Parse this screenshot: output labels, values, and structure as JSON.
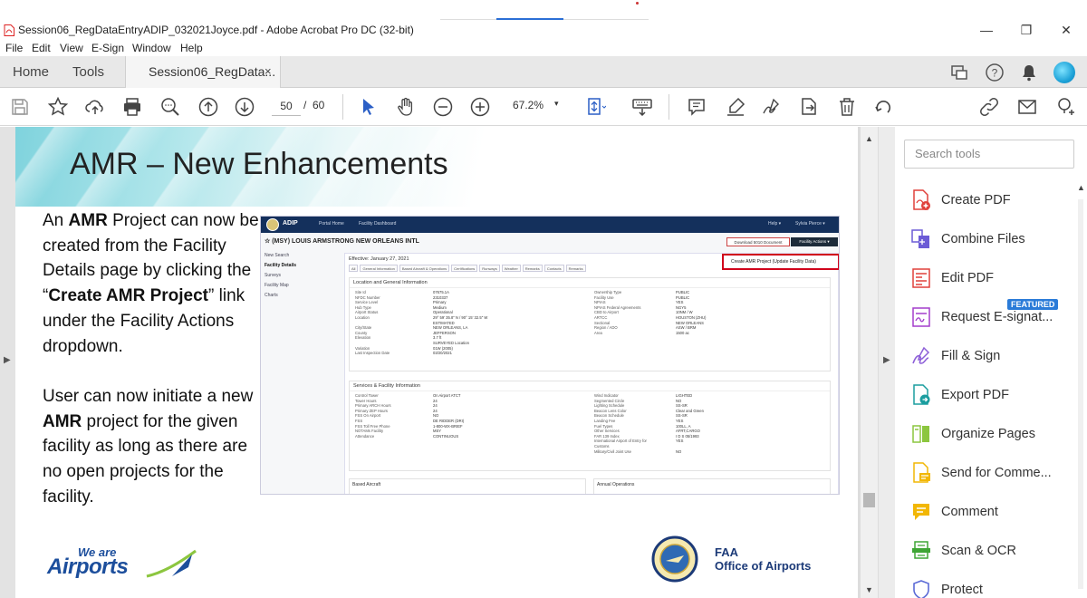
{
  "window": {
    "title": "Session06_RegDataEntryADIP_032021Joyce.pdf - Adobe Acrobat Pro DC (32-bit)",
    "controls": {
      "minimize": "—",
      "restore": "❐",
      "close": "✕"
    }
  },
  "menu": [
    "File",
    "Edit",
    "View",
    "E-Sign",
    "Window",
    "Help"
  ],
  "tabs": {
    "home": "Home",
    "tools": "Tools",
    "document": "Session06_RegData...",
    "close": "×"
  },
  "toolbar": {
    "page_current": "50",
    "page_sep": "/",
    "page_total": "60",
    "zoom": "67.2%",
    "zoom_caret": "▾"
  },
  "colors": {
    "accent_blue": "#2b6fd6",
    "featured_badge": "#2a7bd8",
    "adip_nav": "#14305c",
    "highlight_red": "#d0021b"
  },
  "slide": {
    "title": "AMR – New Enhancements",
    "para1": {
      "t1": "An ",
      "b1": "AMR",
      "t2": " Project can now be created from the Facility Details page by clicking the “",
      "b2": "Create AMR Project",
      "t3": "” link under the Facility Actions dropdown."
    },
    "para2": {
      "t1": "User can now initiate a new ",
      "b1": "AMR",
      "t2": " project for the given facility as long as there are no open projects for the facility."
    },
    "logo_we_are": "We are",
    "logo_airports": "Airports",
    "faa_line1": "FAA",
    "faa_line2": "Office of Airports"
  },
  "screenshot": {
    "brand": "ADIP",
    "nav_links": [
      "Portal Home",
      "Facility Dashboard"
    ],
    "nav_right": [
      "Help ▾",
      "Sylvia Pierce ▾"
    ],
    "facility_title": "☆ (MSY) LOUIS ARMSTRONG NEW ORLEANS INTL",
    "btn_download": "Download 5010 Document",
    "btn_actions": "Facility Actions ▾",
    "sidebar": [
      "New Search",
      "Facility Details",
      "Surveys",
      "Facility Map",
      "Charts"
    ],
    "effective": "Effective: January 27, 2021",
    "tabs": [
      "All",
      "General Information",
      "Based Aircraft & Operations",
      "Certifications",
      "Runways",
      "Weather",
      "Remarks",
      "Contacts",
      "Remarks"
    ],
    "create_link": "Create AMR Project (Update Facility Data)",
    "sec1_title": "Location and General Information",
    "sec1_left_keys": [
      "Site Id",
      "NFDC Number",
      "Service Level",
      "Hub Type",
      "Airport Status",
      "Location",
      "",
      "City/State",
      "County",
      "Elevation",
      "",
      "Variation",
      "Last Inspection Date"
    ],
    "sec1_left_vals": [
      "07675.1A",
      "2310337",
      "Primary",
      "Medium",
      "Operational",
      "29° 59' 35.8\" N / 90° 15' 32.5\" W",
      "ESTIMATED",
      "NEW ORLEANS, LA",
      "JEFFERSON",
      "3.7 ft",
      "SURVEYED Location",
      "01W (2005)",
      "03/20/2021"
    ],
    "sec1_right_keys": [
      "Ownership Type",
      "Facility Use",
      "NPIAS",
      "NPIAS Federal Agreements",
      "CBD to Airport",
      "ARTCC",
      "Sectional",
      "Region / ADO",
      "Area"
    ],
    "sec1_right_vals": [
      "PUBLIC",
      "PUBLIC",
      "YES",
      "NGY5",
      "10NM / W",
      "HOUSTON (ZHU)",
      "NEW ORLEANS",
      "ASW / BRM",
      "1500 ac"
    ],
    "sec2_title": "Services & Facility Information",
    "sec2_left_keys": [
      "Control Tower",
      "Tower Hours",
      "Primary ARCH Hours",
      "Primary ZEP Hours",
      "FSS On Airport",
      "FSS",
      "FSS Toll Free Phone",
      "NOTAMs Facility",
      "Attendance"
    ],
    "sec2_left_vals": [
      "On Airport ATCT",
      "24",
      "24",
      "24",
      "NO",
      "DE RIDDER (DRI)",
      "1-800-WX-BRIEF",
      "MSY",
      "CONTINUOUS"
    ],
    "sec2_right_keys": [
      "Wind Indicator",
      "Segmented Circle",
      "Lighting Schedule",
      "Beacon Lens Color",
      "Beacon Schedule",
      "Landing Fee",
      "Fuel Types",
      "Other Services",
      "FAR 139 Index",
      "International Airport of Entry for",
      "Customs",
      "Military/Civil Joint Use"
    ],
    "sec2_right_vals": [
      "LIGHTED",
      "NO",
      "SS-SR",
      "Clear and Green",
      "SS-SR",
      "YES",
      "100LL, A",
      "AFRT,CARGO",
      "I D S 05/1993",
      "YES",
      "",
      "NO"
    ],
    "card_left": "Based Aircraft",
    "card_right": "Annual Operations"
  },
  "tools_panel": {
    "search_placeholder": "Search tools",
    "featured_badge": "FEATURED",
    "items": [
      {
        "label": "Create PDF",
        "icon": "create-pdf-icon"
      },
      {
        "label": "Combine Files",
        "icon": "combine-files-icon"
      },
      {
        "label": "Edit PDF",
        "icon": "edit-pdf-icon"
      },
      {
        "label": "Request E-signat...",
        "icon": "request-esign-icon"
      },
      {
        "label": "Fill & Sign",
        "icon": "fill-sign-icon"
      },
      {
        "label": "Export PDF",
        "icon": "export-pdf-icon"
      },
      {
        "label": "Organize Pages",
        "icon": "organize-pages-icon"
      },
      {
        "label": "Send for Comme...",
        "icon": "send-comment-icon"
      },
      {
        "label": "Comment",
        "icon": "comment-icon"
      },
      {
        "label": "Scan & OCR",
        "icon": "scan-ocr-icon"
      },
      {
        "label": "Protect",
        "icon": "protect-icon"
      }
    ]
  }
}
